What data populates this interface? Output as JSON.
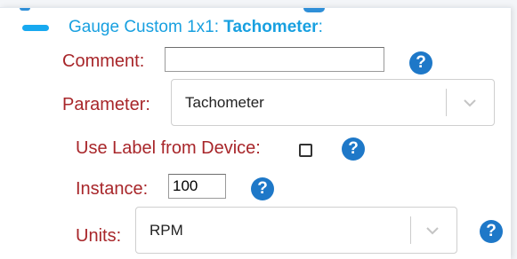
{
  "section": {
    "title_prefix": "Gauge Custom 1x1: ",
    "title_name": "Tachometer",
    "title_suffix": ":"
  },
  "fields": {
    "comment": {
      "label": "Comment:",
      "value": ""
    },
    "parameter": {
      "label": "Parameter:",
      "selected": "Tachometer"
    },
    "use_label": {
      "label": "Use Label from Device:",
      "checked": false
    },
    "instance": {
      "label": "Instance:",
      "value": "100"
    },
    "units": {
      "label": "Units:",
      "selected": "RPM"
    }
  },
  "help_glyph": "?",
  "colors": {
    "label": "#a8262a",
    "title": "#18a0e0",
    "help": "#1e78c8",
    "collapse_bar": "#18a9f0"
  },
  "icons": {
    "collapse": "minus-bar-icon",
    "help": "question-circle-icon",
    "dropdown": "chevron-down-icon"
  }
}
